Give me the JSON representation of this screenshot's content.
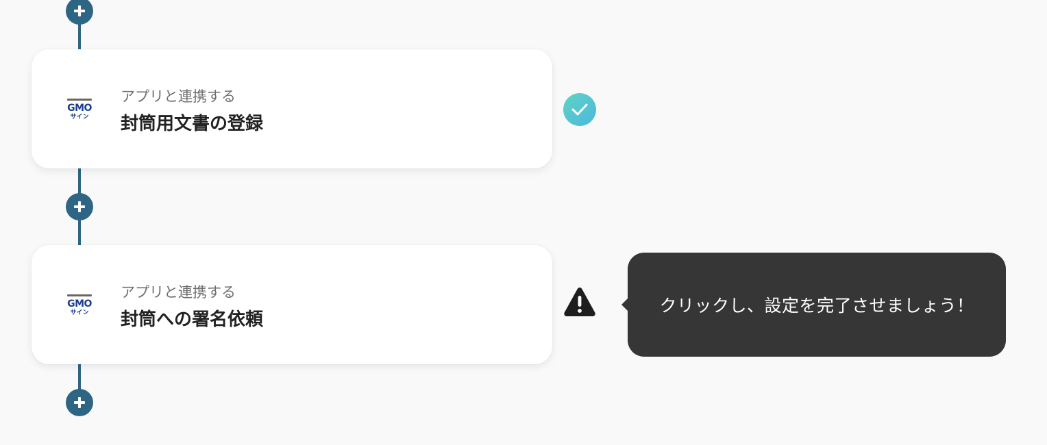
{
  "flow": {
    "steps": [
      {
        "app_icon": "gmo-sign-logo",
        "logo_text": "GMO",
        "logo_subtext": "サイン",
        "subtitle": "アプリと連携する",
        "title": "封筒用文書の登録",
        "status": "complete",
        "status_icon": "check-icon"
      },
      {
        "app_icon": "gmo-sign-logo",
        "logo_text": "GMO",
        "logo_subtext": "サイン",
        "subtitle": "アプリと連携する",
        "title": "封筒への署名依頼",
        "status": "incomplete",
        "status_icon": "warning-icon"
      }
    ],
    "add_button_icon": "plus-icon",
    "line_color": "#2e6585"
  },
  "tooltip": {
    "text": "クリックし、設定を完了させましょう！",
    "background": "#363636"
  },
  "colors": {
    "accent": "#2e6585",
    "check_gradient_start": "#5fd3c3",
    "check_gradient_end": "#4bb8df",
    "title": "#222222",
    "subtitle": "#6f6f6f"
  }
}
